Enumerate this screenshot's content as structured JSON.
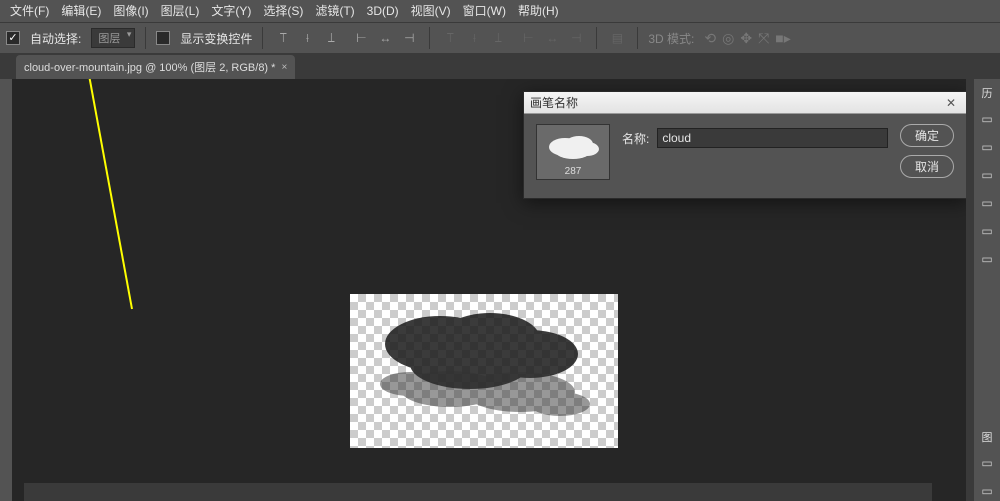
{
  "menu": {
    "items": [
      "文件(F)",
      "编辑(E)",
      "图像(I)",
      "图层(L)",
      "文字(Y)",
      "选择(S)",
      "滤镜(T)",
      "3D(D)",
      "视图(V)",
      "窗口(W)",
      "帮助(H)"
    ]
  },
  "options": {
    "auto_select_label": "自动选择:",
    "auto_select_value": "图层",
    "show_transform_label": "显示变换控件",
    "mode3d_label": "3D 模式:"
  },
  "document": {
    "tab_title": "cloud-over-mountain.jpg @ 100% (图层 2, RGB/8) *"
  },
  "rightpanel": {
    "history_label": "历",
    "lib_label": "图"
  },
  "dialog": {
    "title": "画笔名称",
    "name_label": "名称:",
    "name_value": "cloud",
    "thumb_number": "287",
    "ok_label": "确定",
    "cancel_label": "取消"
  }
}
